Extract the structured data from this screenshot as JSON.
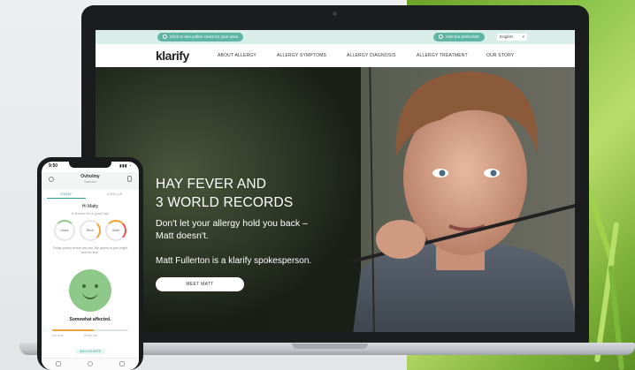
{
  "site": {
    "topbar": {
      "left_pill": "Click to see pollen count for your area",
      "right_pill": "Visit the prescriber",
      "language": "English"
    },
    "logo": "klarify",
    "nav": [
      "ABOUT ALLERGY",
      "ALLERGY SYMPTOMS",
      "ALLERGY DIAGNOSIS",
      "ALLERGY TREATMENT",
      "OUR STORY"
    ],
    "hero": {
      "title_line1": "HAY FEVER AND",
      "title_line2": "3 WORLD RECORDS",
      "subtitle": "Don't let your allergy hold you back – Matt doesn't.",
      "spokesperson": "Matt Fullerton is a klarify spokesperson.",
      "cta": "MEET MATT"
    }
  },
  "phone": {
    "time": "9:50",
    "status": "▮▮▮ ◔",
    "location": "Ovholmy",
    "location_sub": "Sweden",
    "tabs": [
      "TODAY",
      "LOOK UP"
    ],
    "greeting": "Hi Matty",
    "greeting_sub": "It should be a good day",
    "rings": [
      "Grass",
      "Birch",
      "Alder"
    ],
    "note": "Today pollen levels are low. My guess is you might feel be fine.",
    "affected": "Somewhat affected.",
    "slider_low": "Not at all",
    "slider_high": "Really bad",
    "slider_level": 0.55,
    "add_button": "ADD LOG NOTE"
  },
  "colors": {
    "accent": "#5fb5a3",
    "topstrip": "#d9eee9",
    "face": "#8fc98a",
    "slider": "#f0a23a"
  }
}
